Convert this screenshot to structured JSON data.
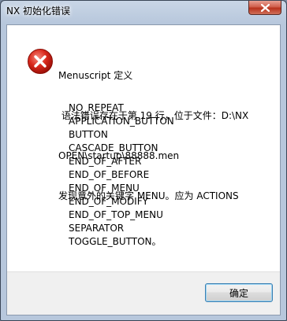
{
  "window": {
    "title": "NX 初始化错误"
  },
  "message": {
    "lines": [
      "Menuscript 定义",
      " 语法错误存在于第 19 行，位于文件：D:\\NX",
      "OPEN\\startup\\88888.men",
      "发现意外的关键字 MENU。应为 ACTIONS"
    ],
    "keywords": [
      "NO_REPEAT",
      "APPLICATION_BUTTON",
      "BUTTON",
      "CASCADE_BUTTON",
      "END_OF_AFTER",
      "END_OF_BEFORE",
      "END_OF_MENU",
      "END_OF_MODIFY",
      "END_OF_TOP_MENU",
      "SEPARATOR",
      "TOGGLE_BUTTON。"
    ]
  },
  "buttons": {
    "ok_label": "确定"
  },
  "icons": {
    "close": "close-icon",
    "error": "error-icon"
  },
  "colors": {
    "error_red": "#d0231b",
    "close_button_red": "#c9452d",
    "footer_gray": "#f0f0f0"
  }
}
